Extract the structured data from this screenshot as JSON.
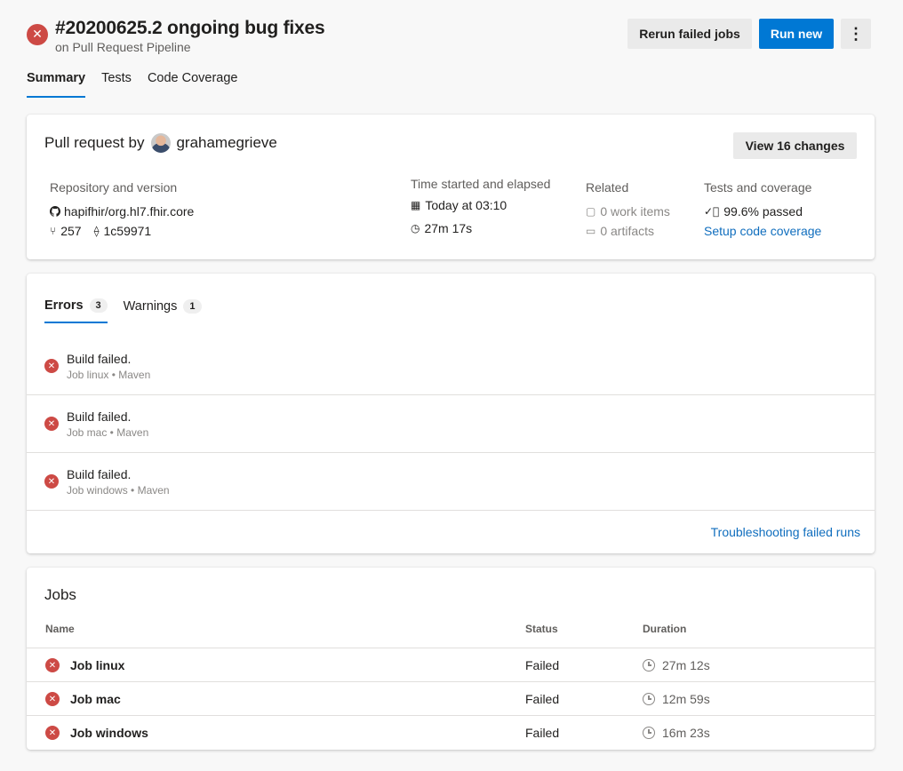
{
  "header": {
    "title": "#20200625.2 ongoing bug fixes",
    "subtitle": "on Pull Request Pipeline",
    "rerun_label": "Rerun failed jobs",
    "run_new_label": "Run new",
    "more_label": "⋮"
  },
  "tabs": [
    "Summary",
    "Tests",
    "Code Coverage"
  ],
  "summary": {
    "pr_prefix": "Pull request by",
    "author": "grahamegrieve",
    "view_changes_label": "View 16 changes",
    "repo_label": "Repository and version",
    "repo_name": "hapifhir/org.hl7.fhir.core",
    "pr_number": "257",
    "commit": "1c59971",
    "time_label": "Time started and elapsed",
    "started": "Today at 03:10",
    "elapsed": "27m 17s",
    "related_label": "Related",
    "work_items": "0 work items",
    "artifacts": "0 artifacts",
    "tests_label": "Tests and coverage",
    "tests_passed": "99.6% passed",
    "coverage_link": "Setup code coverage"
  },
  "issues": {
    "errors_tab": "Errors",
    "errors_count": "3",
    "warnings_tab": "Warnings",
    "warnings_count": "1",
    "items": [
      {
        "title": "Build failed.",
        "sub": "Job linux • Maven"
      },
      {
        "title": "Build failed.",
        "sub": "Job mac • Maven"
      },
      {
        "title": "Build failed.",
        "sub": "Job windows • Maven"
      }
    ],
    "troubleshoot_link": "Troubleshooting failed runs"
  },
  "jobs": {
    "title": "Jobs",
    "headers": {
      "name": "Name",
      "status": "Status",
      "duration": "Duration"
    },
    "rows": [
      {
        "name": "Job linux",
        "status": "Failed",
        "duration": "27m 12s"
      },
      {
        "name": "Job mac",
        "status": "Failed",
        "duration": "12m 59s"
      },
      {
        "name": "Job windows",
        "status": "Failed",
        "duration": "16m 23s"
      }
    ]
  },
  "icons": {
    "failed": "failed-icon",
    "github": "github-icon",
    "pull_request": "pull-request-icon",
    "commit": "commit-icon",
    "calendar": "calendar-icon",
    "clock": "clock-icon",
    "work_item": "work-item-icon",
    "artifact": "artifact-icon",
    "check": "check-circle-icon"
  },
  "colors": {
    "accent": "#0078d4",
    "failed": "#cd4a45",
    "link": "#106ebe"
  }
}
